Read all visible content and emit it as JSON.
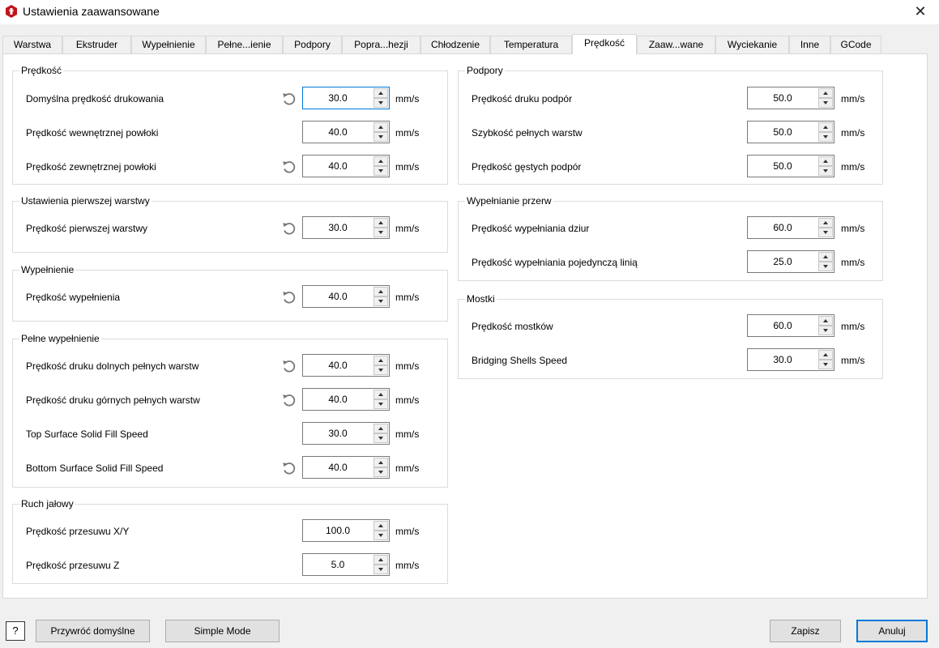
{
  "window": {
    "title": "Ustawienia zaawansowane",
    "close_glyph": "✕"
  },
  "tabs": [
    "Warstwa",
    "Ekstruder",
    "Wypełnienie",
    "Pełne...ienie",
    "Podpory",
    "Popra...hezji",
    "Chłodzenie",
    "Temperatura",
    "Prędkość",
    "Zaaw...wane",
    "Wyciekanie",
    "Inne",
    "GCode"
  ],
  "active_tab": "Prędkość",
  "groups": {
    "predkosc": {
      "title": "Prędkość",
      "rows": [
        {
          "label": "Domyślna prędkość drukowania",
          "value": "30.0",
          "unit": "mm/s",
          "reset": true
        },
        {
          "label": "Prędkość wewnętrznej powłoki",
          "value": "40.0",
          "unit": "mm/s",
          "reset": false
        },
        {
          "label": "Prędkość zewnętrznej powłoki",
          "value": "40.0",
          "unit": "mm/s",
          "reset": true
        }
      ]
    },
    "pierwsza": {
      "title": "Ustawienia pierwszej warstwy",
      "rows": [
        {
          "label": "Prędkość pierwszej warstwy",
          "value": "30.0",
          "unit": "mm/s",
          "reset": true
        }
      ]
    },
    "wypelnienie": {
      "title": "Wypełnienie",
      "rows": [
        {
          "label": "Prędkość wypełnienia",
          "value": "40.0",
          "unit": "mm/s",
          "reset": true
        }
      ]
    },
    "pelne": {
      "title": "Pełne wypełnienie",
      "rows": [
        {
          "label": "Prędkość druku dolnych pełnych warstw",
          "value": "40.0",
          "unit": "mm/s",
          "reset": true
        },
        {
          "label": "Prędkość druku górnych pełnych warstw",
          "value": "40.0",
          "unit": "mm/s",
          "reset": true
        },
        {
          "label": "Top Surface Solid Fill Speed",
          "value": "30.0",
          "unit": "mm/s",
          "reset": false
        },
        {
          "label": "Bottom Surface Solid Fill Speed",
          "value": "40.0",
          "unit": "mm/s",
          "reset": true
        }
      ]
    },
    "ruch": {
      "title": "Ruch jałowy",
      "rows": [
        {
          "label": "Prędkość przesuwu X/Y",
          "value": "100.0",
          "unit": "mm/s",
          "reset": false
        },
        {
          "label": "Prędkość przesuwu Z",
          "value": "5.0",
          "unit": "mm/s",
          "reset": false
        }
      ]
    },
    "podpory": {
      "title": "Podpory",
      "rows": [
        {
          "label": "Prędkość druku podpór",
          "value": "50.0",
          "unit": "mm/s",
          "reset": false
        },
        {
          "label": "Szybkość pełnych warstw",
          "value": "50.0",
          "unit": "mm/s",
          "reset": false
        },
        {
          "label": "Prędkość gęstych podpór",
          "value": "50.0",
          "unit": "mm/s",
          "reset": false
        }
      ]
    },
    "przerwy": {
      "title": "Wypełnianie przerw",
      "rows": [
        {
          "label": "Prędkość wypełniania dziur",
          "value": "60.0",
          "unit": "mm/s",
          "reset": false
        },
        {
          "label": "Prędkość wypełniania pojedynczą linią",
          "value": "25.0",
          "unit": "mm/s",
          "reset": false
        }
      ]
    },
    "mostki": {
      "title": "Mostki",
      "rows": [
        {
          "label": "Prędkość mostków",
          "value": "60.0",
          "unit": "mm/s",
          "reset": false
        },
        {
          "label": "Bridging Shells Speed",
          "value": "30.0",
          "unit": "mm/s",
          "reset": false
        }
      ]
    }
  },
  "footer": {
    "help": "?",
    "restore_defaults": "Przywróć domyślne",
    "simple_mode": "Simple Mode",
    "save": "Zapisz",
    "cancel": "Anuluj"
  },
  "colors": {
    "accent": "#0078d7",
    "app_icon": "#c0161b"
  },
  "icons": {
    "app": "app-logo-icon",
    "reset": "reset-arrow-icon",
    "close": "close-icon"
  }
}
